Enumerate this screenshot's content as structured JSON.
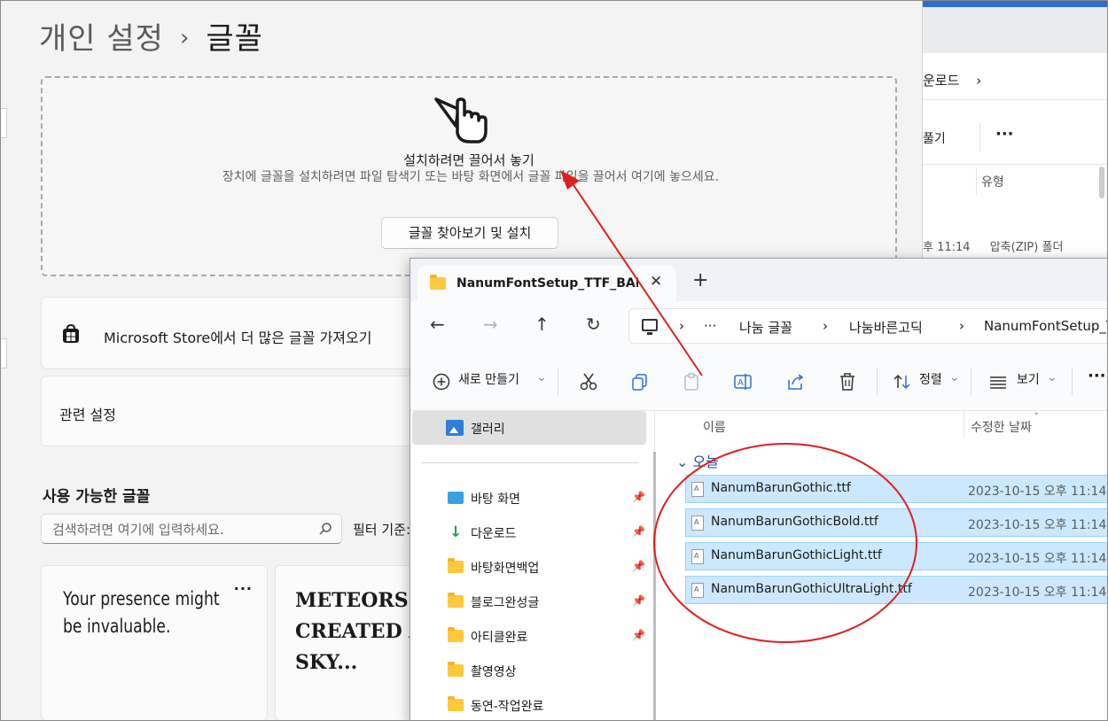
{
  "background_explorer": {
    "address_items": [
      "운로드",
      "›"
    ],
    "toolbar_partial": "풀기",
    "more": "···",
    "column_type": "유형",
    "row_time": "후 11:14",
    "row_type": "압축(ZIP) 폴더"
  },
  "settings": {
    "breadcrumb_parent": "개인 설정",
    "breadcrumb_separator": "›",
    "breadcrumb_current": "글꼴",
    "drop_zone": {
      "title": "설치하려면 끌어서 놓기",
      "description": "장치에 글꼴을 설치하려면 파일 탐색기 또는 바탕 화면에서 글꼴 파일을 끌어서 여기에 놓으세요.",
      "browse_button": "글꼴 찾아보기 및 설치"
    },
    "store_link": "Microsoft Store에서 더 많은 글꼴 가져오기",
    "related_settings": "관련 설정",
    "available_fonts_title": "사용 가능한 글꼴",
    "search_placeholder": "검색하려면 여기에 입력하세요.",
    "filter_label": "필터 기준:",
    "font_cards": [
      {
        "sample": "Your presence might be invaluable.",
        "more": "···"
      },
      {
        "sample": "METEORS\nCREATED A\nSKY..."
      }
    ]
  },
  "explorer": {
    "tab_title": "NanumFontSetup_TTF_BARUN",
    "tab_close": "✕",
    "new_tab": "+",
    "nav": {
      "back": "←",
      "forward": "→",
      "up": "↑",
      "refresh": "↻"
    },
    "address": {
      "chevron": "›",
      "ellipsis": "···",
      "crumbs": [
        "나눔 글꼴",
        "나눔바른고딕",
        "NanumFontSetup_TTF_BARUN"
      ]
    },
    "commands": {
      "new": "새로 만들기",
      "sort": "정렬",
      "view": "보기",
      "dropdown": "⌄",
      "more": "···"
    },
    "navpane": {
      "gallery": "갤러리",
      "items": [
        {
          "label": "바탕 화면",
          "icon": "desktop-icon",
          "pinned": true
        },
        {
          "label": "다운로드",
          "icon": "download-icon",
          "pinned": true
        },
        {
          "label": "바탕화면백업",
          "icon": "folder-icon",
          "pinned": true
        },
        {
          "label": "블로그완성글",
          "icon": "folder-icon",
          "pinned": true
        },
        {
          "label": "아티클완료",
          "icon": "folder-icon",
          "pinned": true
        },
        {
          "label": "촬영영상",
          "icon": "folder-icon",
          "pinned": false
        },
        {
          "label": "동연-작업완료",
          "icon": "folder-icon",
          "pinned": false
        }
      ],
      "pin_glyph": "📌"
    },
    "columns": {
      "name": "이름",
      "date": "수정한 날짜"
    },
    "group_label": "⌄ 오늘",
    "files": [
      {
        "name": "NanumBarunGothic.ttf",
        "date": "2023-10-15 오후 11:14"
      },
      {
        "name": "NanumBarunGothicBold.ttf",
        "date": "2023-10-15 오후 11:14"
      },
      {
        "name": "NanumBarunGothicLight.ttf",
        "date": "2023-10-15 오후 11:14"
      },
      {
        "name": "NanumBarunGothicUltraLight.ttf",
        "date": "2023-10-15 오후 11:14"
      }
    ]
  },
  "annotation_color": "#e02020"
}
